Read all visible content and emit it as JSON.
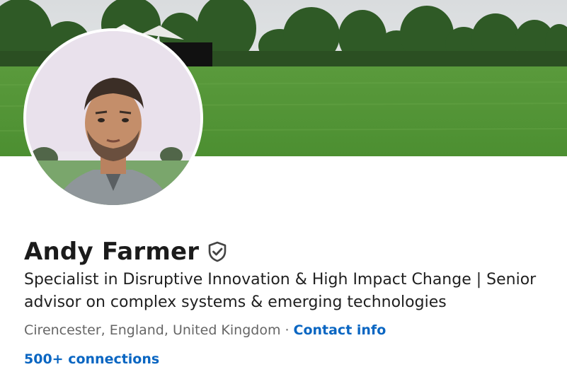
{
  "profile": {
    "name": "Andy Farmer",
    "headline": "Specialist in Disruptive Innovation & High Impact Change | Senior advisor on complex systems & emerging technologies",
    "location": "Cirencester, England, United Kingdom",
    "separator": "·",
    "contact_label": "Contact info",
    "connections_label": "500+ connections"
  },
  "icons": {
    "verified": "shield-check-icon"
  },
  "colors": {
    "link": "#0a66c2",
    "text": "#1b1b1b",
    "muted": "#666666"
  }
}
